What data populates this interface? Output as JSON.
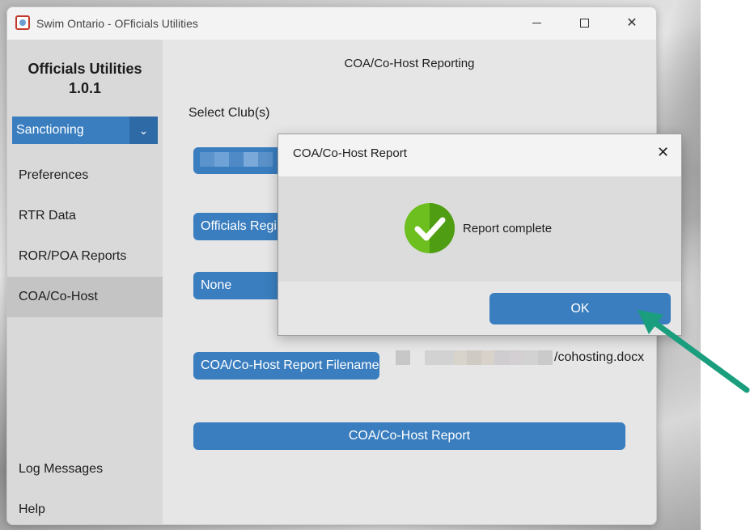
{
  "window": {
    "title": "Swim Ontario - OFficials Utilities",
    "icon": "swim-ontario-logo",
    "controls": {
      "minimize": "minimize",
      "maximize": "maximize",
      "close": "✕"
    }
  },
  "sidebar": {
    "brand_line1": "Officials Utilities",
    "brand_line2": "1.0.1",
    "dropdown": {
      "label": "Sanctioning",
      "icon": "chevron-down-icon",
      "chevron": "⌄"
    },
    "items": [
      {
        "label": "Preferences",
        "active": false
      },
      {
        "label": "RTR Data",
        "active": false
      },
      {
        "label": "ROR/POA Reports",
        "active": false
      },
      {
        "label": "COA/Co-Host",
        "active": true
      }
    ],
    "bottom_items": [
      {
        "label": "Log Messages"
      },
      {
        "label": "Help"
      }
    ]
  },
  "main": {
    "heading": "COA/Co-Host Reporting",
    "select_label": "Select Club(s)",
    "club_button_label": "",
    "officials_button_label": "Officials Regi",
    "none_button_label": "None",
    "filename_button_label": "COA/Co-Host Report Filename",
    "filename_suffix": "/cohosting.docx",
    "report_button_label": "COA/Co-Host Report"
  },
  "dialog": {
    "title": "COA/Co-Host Report",
    "close": "✕",
    "icon": "check-circle-icon",
    "message": "Report complete",
    "ok_label": "OK"
  },
  "colors": {
    "accent_blue": "#3a7ebf",
    "check_green": "#6cbf1f",
    "arrow_green": "#1a9e7d"
  }
}
